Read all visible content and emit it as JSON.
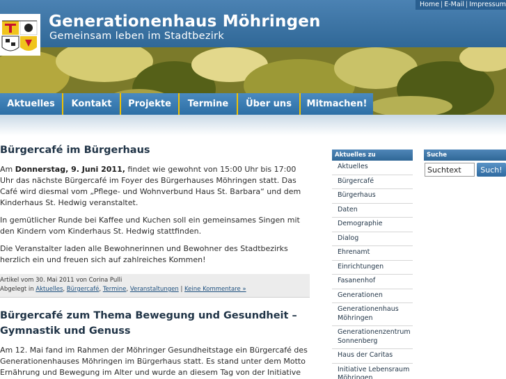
{
  "topnav": [
    "Home",
    "E-Mail",
    "Impressum"
  ],
  "site": {
    "title": "Generationenhaus Möhringen",
    "subtitle": "Gemeinsam leben im Stadtbezirk"
  },
  "mainnav": [
    {
      "label": "Aktuelles"
    },
    {
      "label": "Kontakt"
    },
    {
      "label": "Projekte"
    },
    {
      "label": "Termine"
    },
    {
      "label": "Über uns"
    },
    {
      "label": "Mitmachen!"
    }
  ],
  "post1": {
    "title": "Bürgercafé im Bürgerhaus",
    "p1_pre": "Am ",
    "p1_bold": "Donnerstag, 9. Juni 2011,",
    "p1_post": " findet wie gewohnt von 15:00 Uhr bis 17:00 Uhr das nächste Bürgercafé im Foyer des  Bürgerhauses Möhringen statt. Das Café wird diesmal vom „Pflege- und Wohnverbund Haus St. Barbara“ und dem Kinderhaus St. Hedwig veranstaltet.",
    "p2": "In gemütlicher Runde bei Kaffee und Kuchen soll ein gemeinsames Singen mit den Kindern vom Kinderhaus St. Hedwig stattfinden.",
    "p3": "Die Veranstalter laden alle Bewohnerinnen und Bewohner des Stadtbezirks herzlich ein und freuen sich auf zahlreiches Kommen!",
    "meta_line": "Artikel vom 30. Mai 2011 von Corina Pulli",
    "meta_filed": "Abgelegt in",
    "categories": [
      "Aktuelles",
      "Bürgercafé",
      "Termine",
      "Veranstaltungen"
    ],
    "comments": "Keine Kommentare »"
  },
  "post2": {
    "title": "Bürgercafé zum Thema Bewegung und Gesundheit – Gymnastik und Genuss",
    "p1": "Am 12. Mai fand im Rahmen der Möhringer Gesundheitstage ein Bürgercafé des Generationenhauses Möhringen im Bürgerhaus statt. Es stand unter dem Motto Ernährung und Bewegung im Alter und wurde an diesem Tag von der Initiative"
  },
  "sidebar": {
    "heading": "Aktuelles zu",
    "items": [
      "Aktuelles",
      "Bürgercafé",
      "Bürgerhaus",
      "Daten",
      "Demographie",
      "Dialog",
      "Ehrenamt",
      "Einrichtungen",
      "Fasanenhof",
      "Generationen",
      "Generationenhaus Möhringen",
      "Generationenzentrum Sonnenberg",
      "Haus der Caritas",
      "Initiative Lebensraum Möhringen"
    ]
  },
  "search": {
    "heading": "Suche",
    "value": "Suchtext",
    "button": "Such!"
  },
  "colors": {
    "brand_blue": "#2f6796",
    "nav_separator": "#f2c200"
  }
}
